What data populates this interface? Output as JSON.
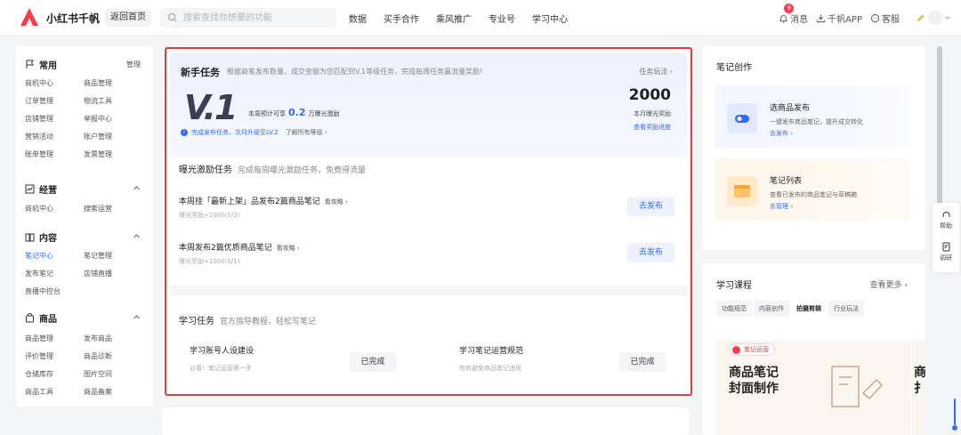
{
  "app": {
    "brand": "小红书千帆",
    "home_button": "返回首页"
  },
  "search": {
    "placeholder": "搜索查找你想要的功能",
    "value": ""
  },
  "nav": [
    "数据",
    "买手合作",
    "乘风推广",
    "专业号",
    "学习中心"
  ],
  "tools": {
    "messages": "消息",
    "message_badge": "9",
    "app": "千帆APP",
    "service": "客服"
  },
  "colors": {
    "accent": "#2f6bff",
    "brand_red": "#ff3b4a",
    "highlight_border": "#e23c3c"
  },
  "sidebar": {
    "common": {
      "title": "常用",
      "manage": "管理",
      "items": [
        "商机中心",
        "商品管理",
        "订单管理",
        "物流工具",
        "店铺管理",
        "举报中心",
        "营销活动",
        "账户管理",
        "账单管理",
        "发票管理"
      ]
    },
    "business": {
      "title": "经营",
      "items": [
        "商机中心",
        "搜索运营"
      ]
    },
    "content": {
      "title": "内容",
      "items": [
        "笔记中心",
        "笔记管理",
        "发布笔记",
        "店铺直播",
        "直播中控台"
      ],
      "active_index": 0
    },
    "goods": {
      "title": "商品",
      "items": [
        "商品管理",
        "发布商品",
        "评价管理",
        "商品诊断",
        "仓储库存",
        "图片空间",
        "商品工具",
        "商品备案"
      ]
    }
  },
  "newbie": {
    "title": "新手任务",
    "subtitle": "根据商笔发布数量、成交金额为您匹配到V.1等级任务，完成每周任务赢流量奖励!",
    "rules_link": "任务玩法 ›",
    "level": "V.1",
    "weekly_prefix": "本周预计可享",
    "weekly_value": "0.2",
    "weekly_suffix": "万曝光激励",
    "notice": "完成发布任务，次月升级至LV.2",
    "notice_link": "了解所有等级 ›",
    "exposure_value": "2000",
    "exposure_label": "本月曝光奖励",
    "exposure_link": "查看奖励进度"
  },
  "exposure_tasks": {
    "title": "曝光激励任务",
    "subtitle": "完成每周曝光激励任务，免费得流量",
    "tasks": [
      {
        "title": "本周挂「最新上架」品发布2篇商品笔记",
        "guide": "看攻略 ›",
        "reward": "曝光奖励+1000(0/2)",
        "action": "去发布"
      },
      {
        "title": "本周发布2篇优质商品笔记",
        "guide": "看攻略 ›",
        "reward": "曝光奖励+1000(0/1)",
        "action": "去发布"
      }
    ]
  },
  "learning_tasks": {
    "title": "学习任务",
    "subtitle": "官方指导教程，轻松写笔记",
    "cards": [
      {
        "title": "学习账号人设建设",
        "sub": "必看！笔记运营第一步",
        "status": "已完成"
      },
      {
        "title": "学习笔记运营规范",
        "sub": "有效避免商品笔记违规",
        "status": "已完成"
      }
    ]
  },
  "note_creation": {
    "title": "笔记创作",
    "items": [
      {
        "name": "选商品发布",
        "desc": "一键发布商品笔记，提升成交转化",
        "link": "去发布 ›"
      },
      {
        "name": "笔记列表",
        "desc": "查看已发布的商品笔记与草稿箱",
        "link": "去管理 ›"
      }
    ]
  },
  "courses": {
    "title": "学习课程",
    "more": "查看更多 ›",
    "tabs": [
      "功能规范",
      "内容创作",
      "拍摄剪辑",
      "行业玩法"
    ],
    "active_tab": 2,
    "banner_tag": "笔记运营",
    "banner_line1": "商品笔记",
    "banner_line2": "封面制作",
    "peek_chars": [
      "商",
      "扌"
    ]
  },
  "float_bar": {
    "help": "帮助",
    "survey": "调研"
  }
}
